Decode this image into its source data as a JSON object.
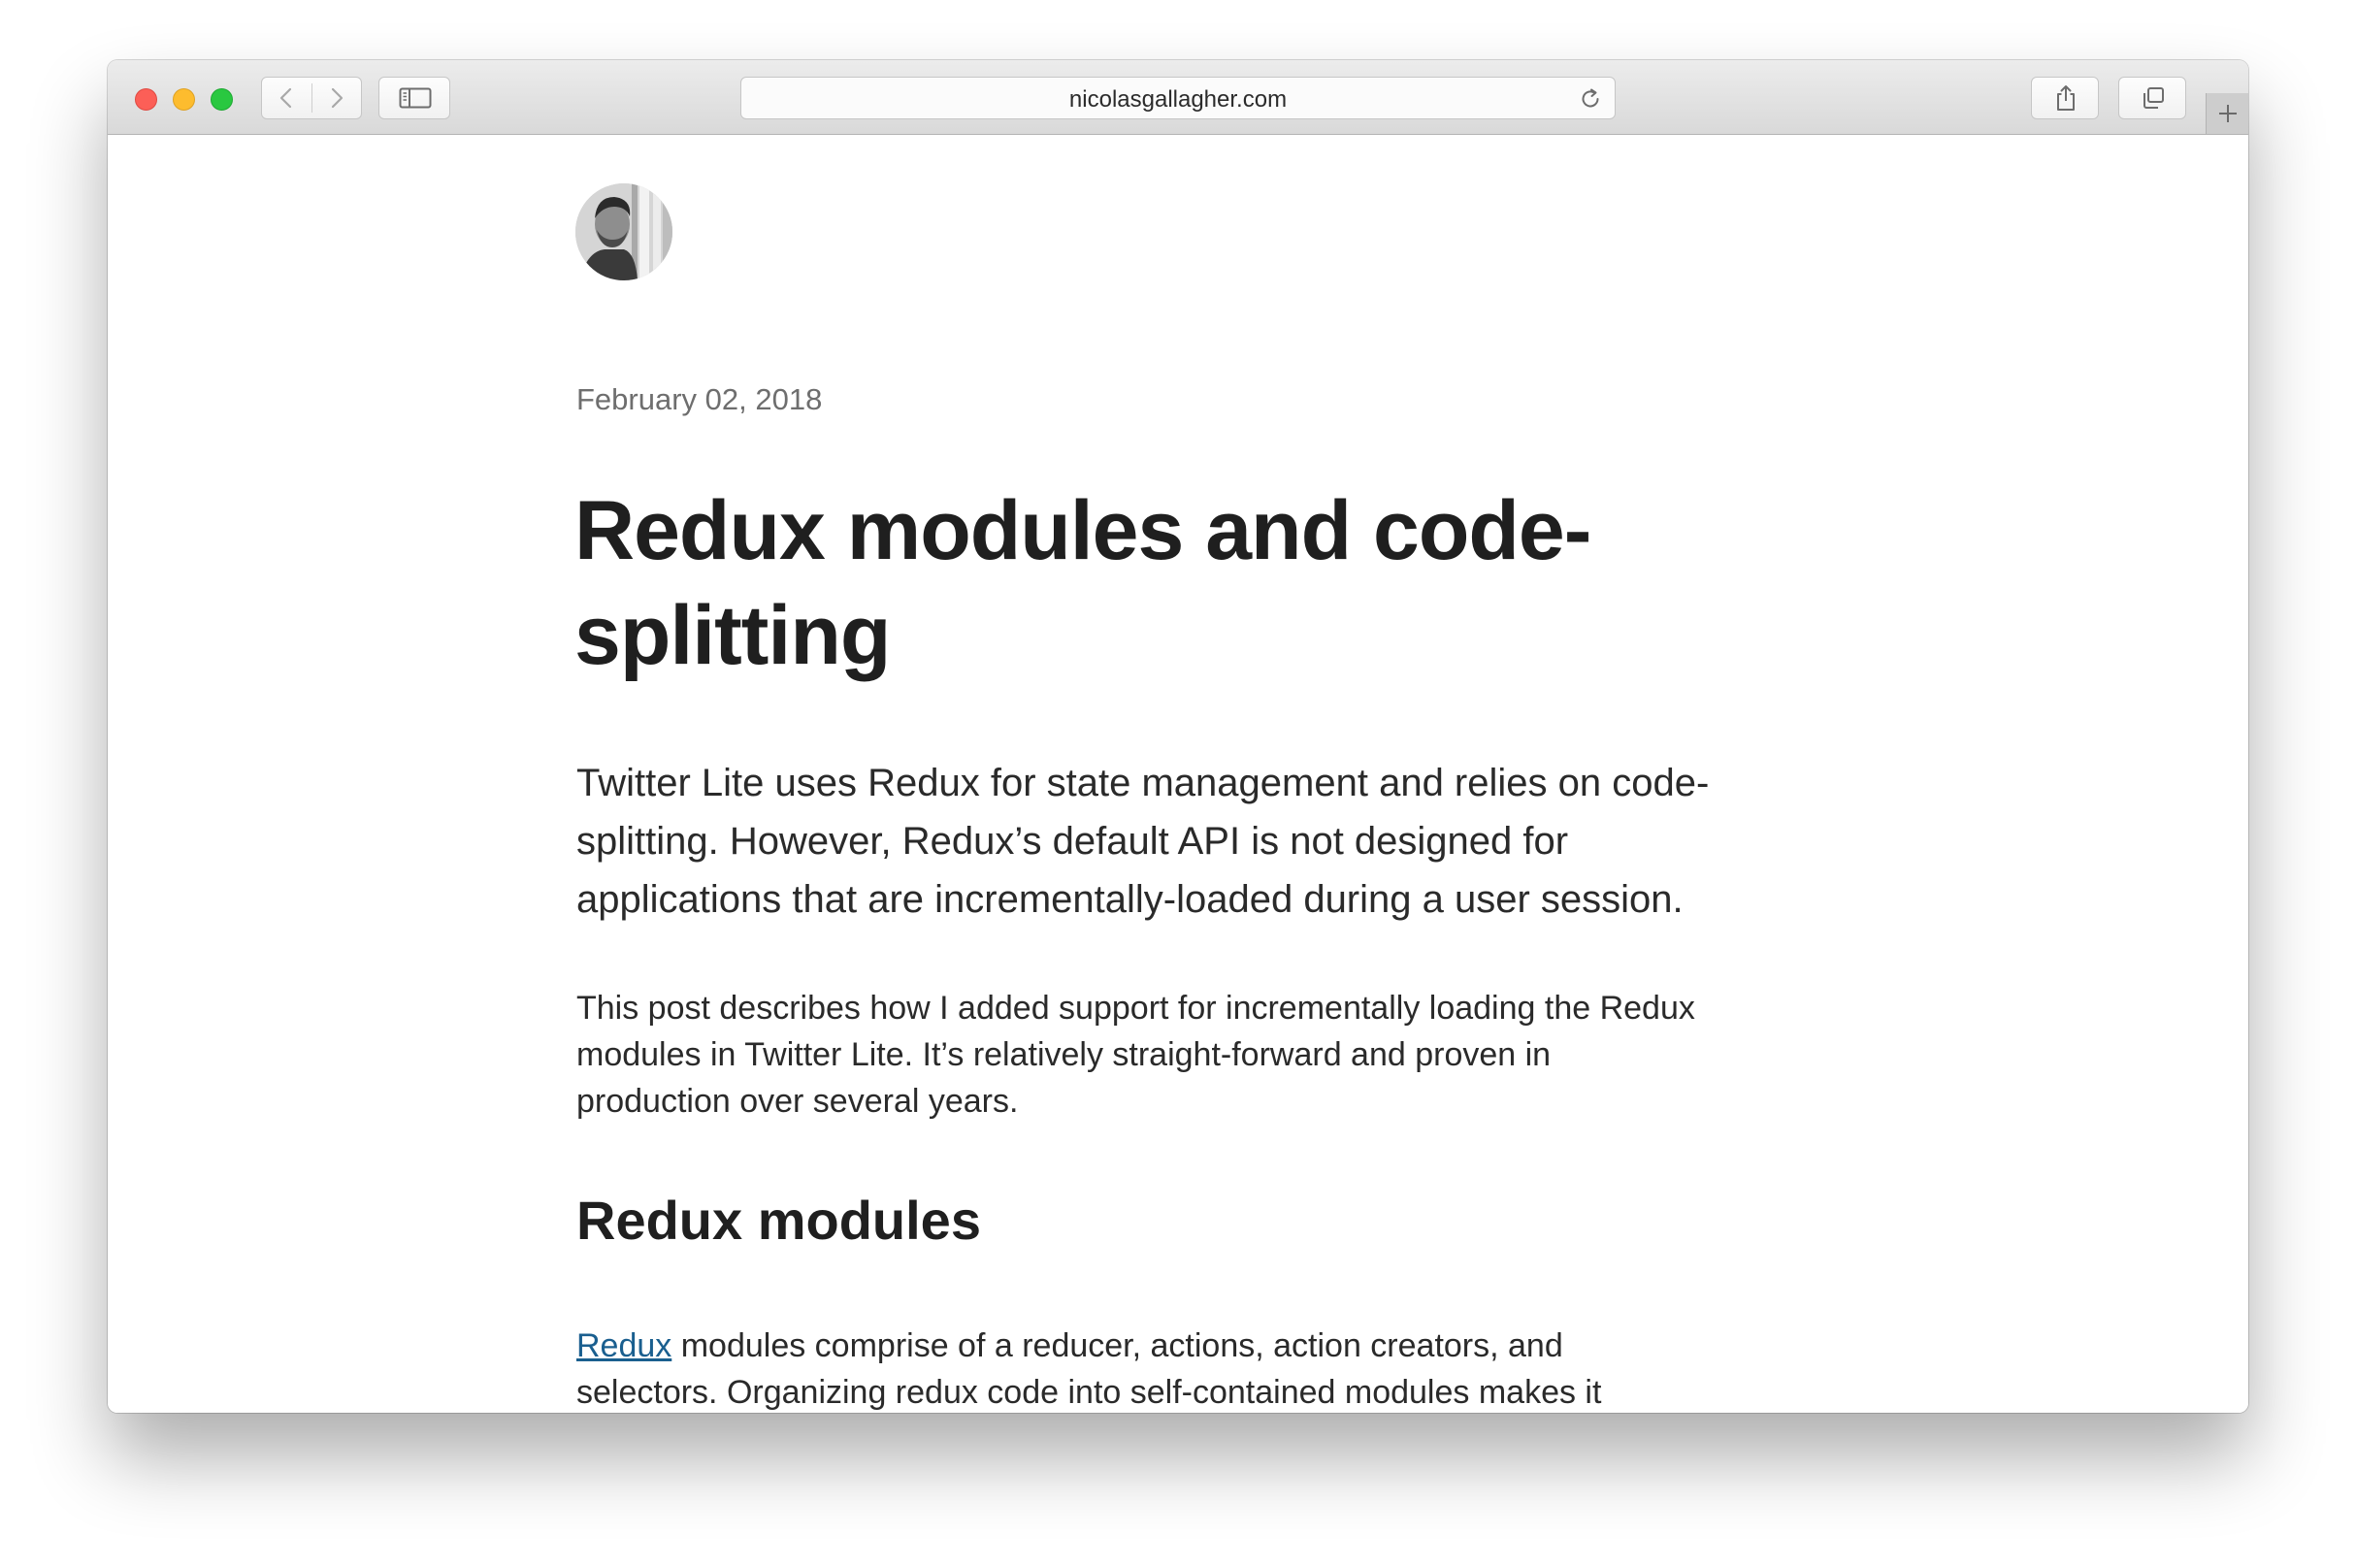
{
  "browser": {
    "address_text": "nicolasgallagher.com",
    "icons": [
      "close",
      "minimize",
      "zoom",
      "chevron-left",
      "chevron-right",
      "sidebar",
      "reload",
      "share",
      "tabs",
      "plus"
    ],
    "colors": {
      "close": "#fc5f57",
      "minimize": "#fdbc2e",
      "zoom": "#29c840"
    }
  },
  "post": {
    "date": "February 02, 2018",
    "title_line1": "Redux modules and code-",
    "title_line2": "splitting",
    "lead_lines": [
      "Twitter Lite uses Redux for state management and relies on code-",
      "splitting. However, Redux’s default API is not designed for",
      "applications that are incrementally-loaded during a user session."
    ],
    "para_lines": [
      "This post describes how I added support for incrementally loading the Redux",
      "modules in Twitter Lite. It’s relatively straight-forward and proven in",
      "production over several years."
    ],
    "section_heading": "Redux modules",
    "para2_link": "Redux",
    "para2_line1_rest": " modules comprise of a reducer, actions, action creators, and",
    "para2_line2": "selectors. Organizing redux code into self-contained modules makes it",
    "link_color": "#1a5f8f"
  }
}
